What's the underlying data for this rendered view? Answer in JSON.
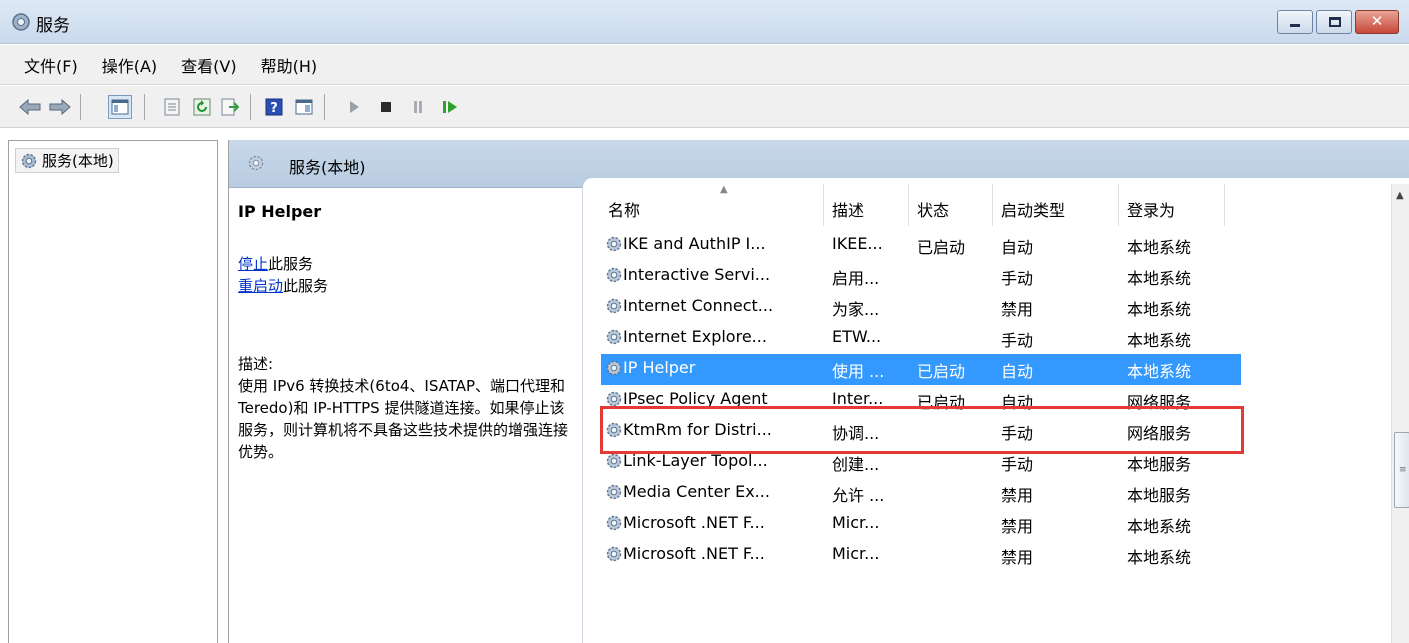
{
  "window": {
    "title": "服务"
  },
  "menubar": {
    "items": [
      "文件(F)",
      "操作(A)",
      "查看(V)",
      "帮助(H)"
    ]
  },
  "toolbar": {
    "icons": [
      "back-arrow-icon",
      "forward-arrow-icon",
      "show-hide-tree-icon",
      "properties-icon",
      "refresh-icon",
      "export-list-icon",
      "help-icon",
      "view-icon",
      "start-service-icon",
      "stop-service-icon",
      "pause-service-icon",
      "restart-service-icon"
    ]
  },
  "tree": {
    "root_label": "服务(本地)"
  },
  "pane": {
    "title": "服务(本地)"
  },
  "details": {
    "service_name": "IP Helper",
    "stop_link": "停止",
    "stop_suffix": "此服务",
    "restart_link": "重启动",
    "restart_suffix": "此服务",
    "description_label": "描述:",
    "description": "使用 IPv6 转换技术(6to4、ISATAP、端口代理和 Teredo)和 IP-HTTPS 提供隧道连接。如果停止该服务，则计算机将不具备这些技术提供的增强连接优势。"
  },
  "table": {
    "columns": [
      "名称",
      "描述",
      "状态",
      "启动类型",
      "登录为"
    ],
    "rows": [
      {
        "name": "IKE and AuthIP I...",
        "desc": "IKEE...",
        "status": "已启动",
        "startup": "自动",
        "logon": "本地系统"
      },
      {
        "name": "Interactive Servi...",
        "desc": "启用...",
        "status": "",
        "startup": "手动",
        "logon": "本地系统"
      },
      {
        "name": "Internet Connect...",
        "desc": "为家...",
        "status": "",
        "startup": "禁用",
        "logon": "本地系统"
      },
      {
        "name": "Internet Explore...",
        "desc": "ETW...",
        "status": "",
        "startup": "手动",
        "logon": "本地系统"
      },
      {
        "name": "IP Helper",
        "desc": "使用 ...",
        "status": "已启动",
        "startup": "自动",
        "logon": "本地系统"
      },
      {
        "name": "IPsec Policy Agent",
        "desc": "Inter...",
        "status": "已启动",
        "startup": "自动",
        "logon": "网络服务"
      },
      {
        "name": "KtmRm for Distri...",
        "desc": "协调...",
        "status": "",
        "startup": "手动",
        "logon": "网络服务"
      },
      {
        "name": "Link-Layer Topol...",
        "desc": "创建...",
        "status": "",
        "startup": "手动",
        "logon": "本地服务"
      },
      {
        "name": "Media Center Ex...",
        "desc": "允许 ...",
        "status": "",
        "startup": "禁用",
        "logon": "本地服务"
      },
      {
        "name": "Microsoft .NET F...",
        "desc": "Micr...",
        "status": "",
        "startup": "禁用",
        "logon": "本地系统"
      },
      {
        "name": "Microsoft .NET F...",
        "desc": "Micr...",
        "status": "",
        "startup": "禁用",
        "logon": "本地系统"
      }
    ],
    "selected_row": 4
  },
  "colors": {
    "selection": "#3399ff",
    "highlight_box": "#e53935",
    "link": "#0033cc"
  }
}
